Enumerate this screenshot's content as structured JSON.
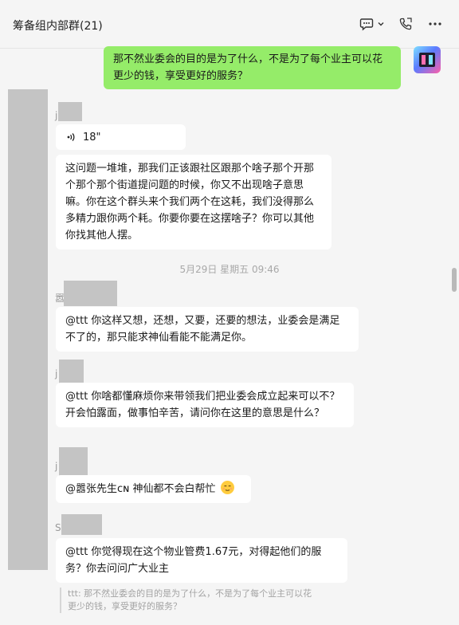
{
  "header": {
    "title": "筹备组内部群(21)",
    "icons": [
      "chat-icon",
      "chevron-down-icon",
      "phone-icon",
      "more-icon"
    ]
  },
  "messages": {
    "m1": {
      "text": "那不然业委会的目的是为了什么，不是为了每个业主可以花更少的钱，享受更好的服务？"
    },
    "s1": {
      "name_visible": "j"
    },
    "m2": {
      "duration": "18\""
    },
    "m3": {
      "text": "这问题一堆堆，那我们正该跟社区跟那个啥子那个开那个那个那个街道提问题的时候，你又不出现啥子意思嘛。你在这个群头来个我们两个在这耗，我们没得那么多精力跟你两个耗。你要你要在这摆啥子？你可以其他你找其他人摆。"
    },
    "ts": "5月29日 星期五 09:46",
    "s2": {
      "name_visible": "嚣"
    },
    "m4": {
      "text": "@ttt 你这样又想，还想，又要，还要的想法，业委会是满足不了的，那只能求神仙看能不能满足你。"
    },
    "s3": {
      "name_visible": "j"
    },
    "m5": {
      "text": "@ttt 你啥都懂麻烦你来带领我们把业委会成立起来可以不？开会怕露面，做事怕辛苦，请问你在这里的意思是什么？"
    },
    "s4": {
      "name_visible": "j"
    },
    "m6": {
      "text": "@嚣张先生ᴄɴ 神仙都不会白帮忙"
    },
    "s5": {
      "name_visible": "S"
    },
    "m7": {
      "text": "@ttt 你觉得现在这个物业管费1.67元，对得起他们的服务？你去问问广大业主"
    },
    "quote": {
      "text": "ttt: 那不然业委会的目的是为了什么，不是为了每个业主可以花更少的钱，享受更好的服务？"
    }
  },
  "colors": {
    "mine_bubble": "#95ec69",
    "other_bubble": "#ffffff",
    "background": "#f5f5f5"
  }
}
